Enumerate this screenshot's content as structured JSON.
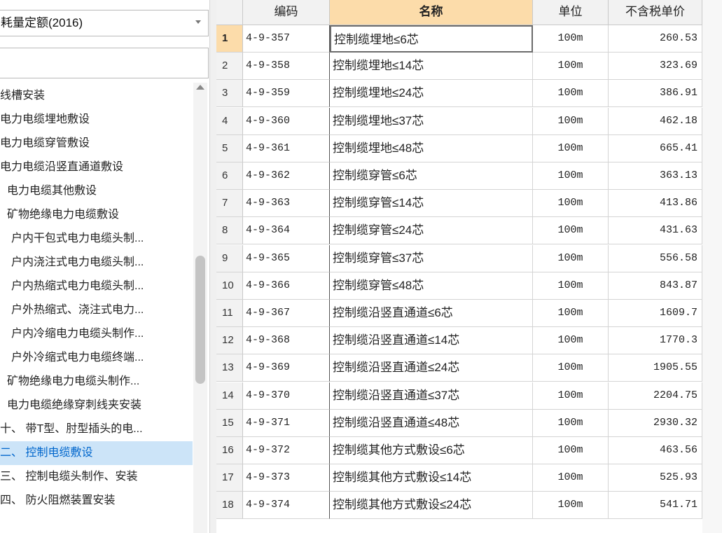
{
  "left": {
    "quota_select": "耗量定额(2016)",
    "search_placeholder": "",
    "tree": [
      "线槽安装",
      "电力电缆埋地敷设",
      "电力电缆穿管敷设",
      "电力电缆沿竖直通道敷设",
      "电力电缆其他敷设",
      "矿物绝缘电力电缆敷设",
      "户内干包式电力电缆头制...",
      "户内浇注式电力电缆头制...",
      "户内热缩式电力电缆头制...",
      "户外热缩式、浇注式电力...",
      "户内冷缩电力电缆头制作...",
      "户外冷缩式电力电缆终端...",
      "矿物绝缘电力电缆头制作...",
      "电力电缆绝缘穿刺线夹安装",
      "十、 带T型、肘型插头的电...",
      "二、 控制电缆敷设",
      "三、 控制电缆头制作、安装",
      "四、 防火阻燃装置安装"
    ],
    "selected_index": 15
  },
  "grid": {
    "headers": [
      "",
      "编码",
      "名称",
      "单位",
      "不含税单价"
    ],
    "rows": [
      {
        "n": "1",
        "code": "4-9-357",
        "name": "控制缆埋地≤6芯",
        "unit": "100m",
        "price": "260.53"
      },
      {
        "n": "2",
        "code": "4-9-358",
        "name": "控制缆埋地≤14芯",
        "unit": "100m",
        "price": "323.69"
      },
      {
        "n": "3",
        "code": "4-9-359",
        "name": "控制缆埋地≤24芯",
        "unit": "100m",
        "price": "386.91"
      },
      {
        "n": "4",
        "code": "4-9-360",
        "name": "控制缆埋地≤37芯",
        "unit": "100m",
        "price": "462.18"
      },
      {
        "n": "5",
        "code": "4-9-361",
        "name": "控制缆埋地≤48芯",
        "unit": "100m",
        "price": "665.41"
      },
      {
        "n": "6",
        "code": "4-9-362",
        "name": "控制缆穿管≤6芯",
        "unit": "100m",
        "price": "363.13"
      },
      {
        "n": "7",
        "code": "4-9-363",
        "name": "控制缆穿管≤14芯",
        "unit": "100m",
        "price": "413.86"
      },
      {
        "n": "8",
        "code": "4-9-364",
        "name": "控制缆穿管≤24芯",
        "unit": "100m",
        "price": "431.63"
      },
      {
        "n": "9",
        "code": "4-9-365",
        "name": "控制缆穿管≤37芯",
        "unit": "100m",
        "price": "556.58"
      },
      {
        "n": "10",
        "code": "4-9-366",
        "name": "控制缆穿管≤48芯",
        "unit": "100m",
        "price": "843.87"
      },
      {
        "n": "11",
        "code": "4-9-367",
        "name": "控制缆沿竖直通道≤6芯",
        "unit": "100m",
        "price": "1609.7"
      },
      {
        "n": "12",
        "code": "4-9-368",
        "name": "控制缆沿竖直通道≤14芯",
        "unit": "100m",
        "price": "1770.3"
      },
      {
        "n": "13",
        "code": "4-9-369",
        "name": "控制缆沿竖直通道≤24芯",
        "unit": "100m",
        "price": "1905.55"
      },
      {
        "n": "14",
        "code": "4-9-370",
        "name": "控制缆沿竖直通道≤37芯",
        "unit": "100m",
        "price": "2204.75"
      },
      {
        "n": "15",
        "code": "4-9-371",
        "name": "控制缆沿竖直通道≤48芯",
        "unit": "100m",
        "price": "2930.32"
      },
      {
        "n": "16",
        "code": "4-9-372",
        "name": "控制缆其他方式敷设≤6芯",
        "unit": "100m",
        "price": "463.56"
      },
      {
        "n": "17",
        "code": "4-9-373",
        "name": "控制缆其他方式敷设≤14芯",
        "unit": "100m",
        "price": "525.93"
      },
      {
        "n": "18",
        "code": "4-9-374",
        "name": "控制缆其他方式敷设≤24芯",
        "unit": "100m",
        "price": "541.71"
      }
    ]
  }
}
